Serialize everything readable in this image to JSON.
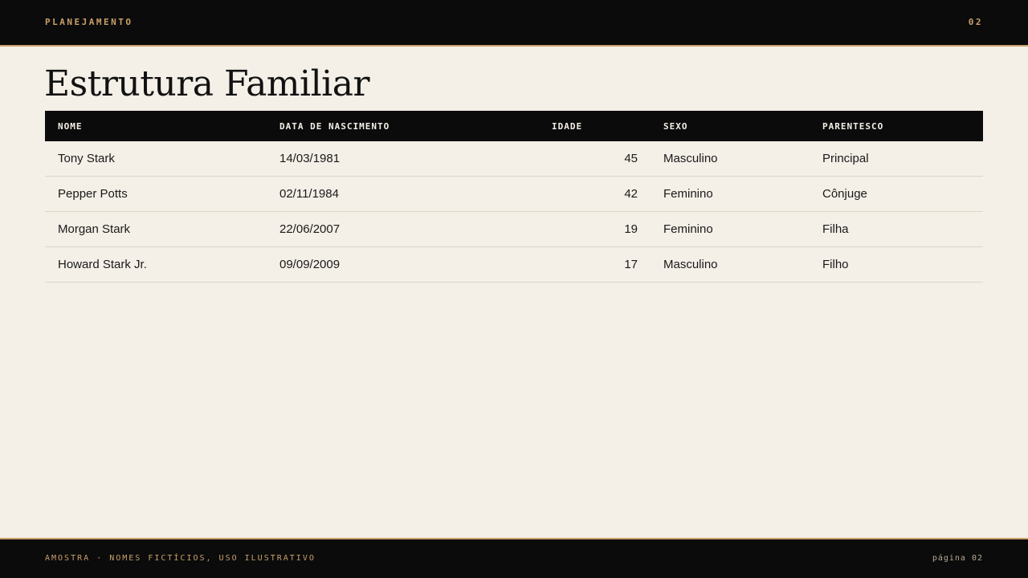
{
  "header": {
    "section": "PLANEJAMENTO",
    "slide_number": "02"
  },
  "title": "Estrutura Familiar",
  "table": {
    "columns": [
      "NOME",
      "DATA DE NASCIMENTO",
      "IDADE",
      "SEXO",
      "PARENTESCO"
    ],
    "rows": [
      {
        "nome": "Tony Stark",
        "data": "14/03/1981",
        "idade": "45",
        "sexo": "Masculino",
        "parentesco": "Principal"
      },
      {
        "nome": "Pepper Potts",
        "data": "02/11/1984",
        "idade": "42",
        "sexo": "Feminino",
        "parentesco": "Cônjuge"
      },
      {
        "nome": "Morgan Stark",
        "data": "22/06/2007",
        "idade": "19",
        "sexo": "Feminino",
        "parentesco": "Filha"
      },
      {
        "nome": "Howard Stark Jr.",
        "data": "09/09/2009",
        "idade": "17",
        "sexo": "Masculino",
        "parentesco": "Filho"
      }
    ]
  },
  "footer": {
    "note": "AMOSTRA · NOMES FICTÍCIOS, USO ILUSTRATIVO",
    "page": "página 02"
  },
  "colors": {
    "background": "#f4efe7",
    "dark": "#0b0b0b",
    "accent": "#c9a06a"
  }
}
